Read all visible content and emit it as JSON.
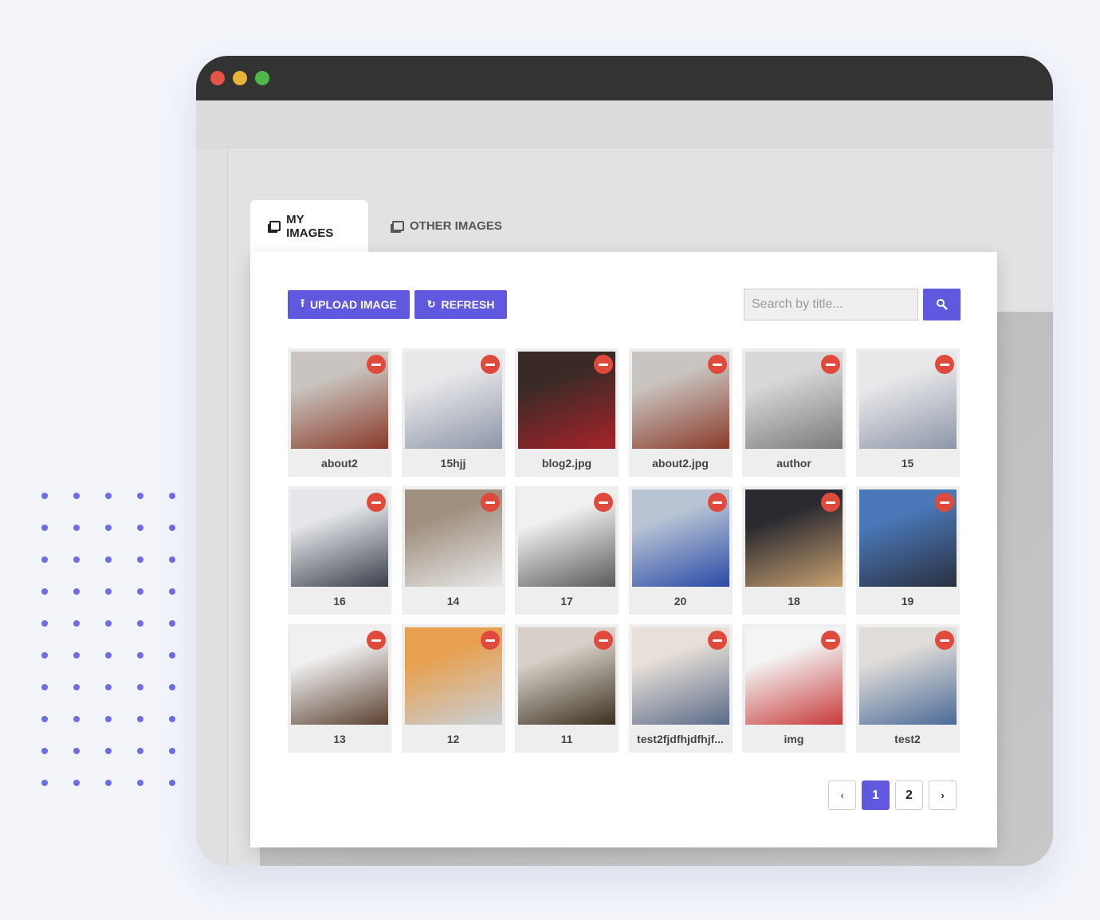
{
  "window": {
    "controls": [
      "close",
      "minimize",
      "maximize"
    ],
    "colors": {
      "close": "#e5534b",
      "minimize": "#e8b43c",
      "maximize": "#4fb848"
    }
  },
  "tabs": [
    {
      "label": "MY IMAGES",
      "active": true,
      "icon": "images-icon"
    },
    {
      "label": "OTHER IMAGES",
      "active": false,
      "icon": "images-icon"
    }
  ],
  "toolbar": {
    "upload_label": "UPLOAD IMAGE",
    "refresh_label": "REFRESH",
    "search_placeholder": "Search by title...",
    "search_icon": "search-icon"
  },
  "accent": "#6158e0",
  "images": [
    {
      "title": "about2",
      "colors": [
        "#c9c4bf",
        "#8a3a2a"
      ]
    },
    {
      "title": "15hjj",
      "colors": [
        "#e8e8ea",
        "#8d96a8"
      ]
    },
    {
      "title": "blog2.jpg",
      "colors": [
        "#3a2a26",
        "#a8232a"
      ]
    },
    {
      "title": "about2.jpg",
      "colors": [
        "#c9c4bf",
        "#8a3a2a"
      ]
    },
    {
      "title": "author",
      "colors": [
        "#d8d8d8",
        "#7a7a7a"
      ]
    },
    {
      "title": "15",
      "colors": [
        "#e8e8ea",
        "#8d96a8"
      ]
    },
    {
      "title": "16",
      "colors": [
        "#e4e6ea",
        "#3a3f4a"
      ]
    },
    {
      "title": "14",
      "colors": [
        "#a09080",
        "#e8e8e8"
      ]
    },
    {
      "title": "17",
      "colors": [
        "#f0f0f0",
        "#5a5a5a"
      ]
    },
    {
      "title": "20",
      "colors": [
        "#b8c4d4",
        "#2a4aa8"
      ]
    },
    {
      "title": "18",
      "colors": [
        "#2a2a30",
        "#c8a070"
      ]
    },
    {
      "title": "19",
      "colors": [
        "#4a78b8",
        "#2a3040"
      ]
    },
    {
      "title": "13",
      "colors": [
        "#f0f0f0",
        "#5a4030"
      ]
    },
    {
      "title": "12",
      "colors": [
        "#e8a050",
        "#c8d0d8"
      ]
    },
    {
      "title": "11",
      "colors": [
        "#d8d0c8",
        "#3a3020"
      ]
    },
    {
      "title": "test2fjdfhjdfhjf...",
      "colors": [
        "#e8e0d8",
        "#5a6a88"
      ]
    },
    {
      "title": "img",
      "colors": [
        "#f4f4f4",
        "#c83a3a"
      ]
    },
    {
      "title": "test2",
      "colors": [
        "#e0dcd8",
        "#4a6a98"
      ]
    }
  ],
  "pagination": {
    "prev_icon": "chevron-left-icon",
    "pages": [
      "1",
      "2"
    ],
    "current": "1",
    "next_icon": "chevron-right-icon"
  }
}
